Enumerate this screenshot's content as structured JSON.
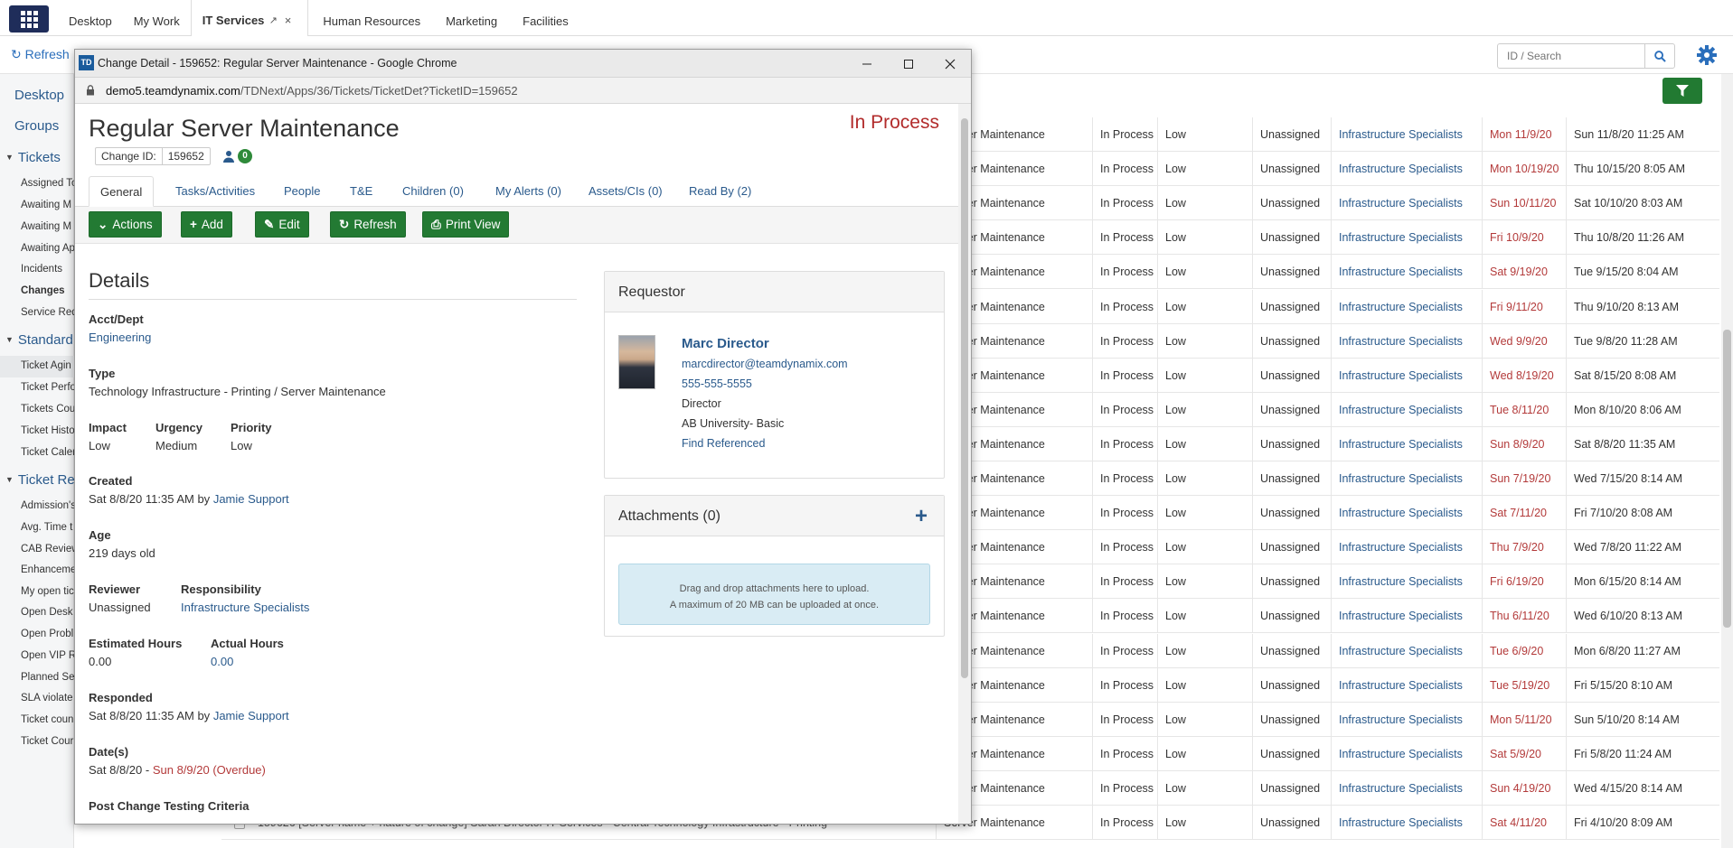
{
  "top_tabs": [
    {
      "label": "Desktop"
    },
    {
      "label": "My Work"
    },
    {
      "label": "IT Services",
      "pin_icon": "↗",
      "close_icon": "×"
    },
    {
      "label": "Human Resources"
    },
    {
      "label": "Marketing"
    },
    {
      "label": "Facilities"
    }
  ],
  "subbar": {
    "refresh_label": "Refresh",
    "search_placeholder": "ID / Search"
  },
  "leftnav": {
    "top_links": [
      "Desktop",
      "Groups"
    ],
    "sections": [
      {
        "title": "Tickets",
        "items": [
          "Assigned To",
          "Awaiting M",
          "Awaiting M",
          "Awaiting Ap",
          "Incidents",
          "Changes",
          "Service Req"
        ]
      },
      {
        "title": "Standard R",
        "items": [
          "Ticket Agin",
          "Ticket Perfo",
          "Tickets Cou",
          "Ticket Histo",
          "Ticket Caler"
        ]
      },
      {
        "title": "Ticket Rep",
        "items": [
          "Admission's",
          "Avg. Time t",
          "CAB Review",
          "Enhanceme",
          "My open tic",
          "Open Desk",
          "Open Probl",
          "Open VIP R",
          "Planned Se",
          "SLA violate",
          "Ticket coun",
          "Ticket Cour"
        ]
      }
    ],
    "selected_item": "Changes"
  },
  "table": {
    "rows": [
      {
        "subject": "Server Maintenance",
        "status": "In Process",
        "priority": "Low",
        "assigned": "Unassigned",
        "responsibility": "Infrastructure Specialists",
        "due": "Mon 11/9/20",
        "modified": "Sun 11/8/20 11:25 AM"
      },
      {
        "subject": "Server Maintenance",
        "status": "In Process",
        "priority": "Low",
        "assigned": "Unassigned",
        "responsibility": "Infrastructure Specialists",
        "due": "Mon 10/19/20",
        "modified": "Thu 10/15/20 8:05 AM"
      },
      {
        "subject": "Server Maintenance",
        "status": "In Process",
        "priority": "Low",
        "assigned": "Unassigned",
        "responsibility": "Infrastructure Specialists",
        "due": "Sun 10/11/20",
        "modified": "Sat 10/10/20 8:03 AM"
      },
      {
        "subject": "Server Maintenance",
        "status": "In Process",
        "priority": "Low",
        "assigned": "Unassigned",
        "responsibility": "Infrastructure Specialists",
        "due": "Fri 10/9/20",
        "modified": "Thu 10/8/20 11:26 AM"
      },
      {
        "subject": "Server Maintenance",
        "status": "In Process",
        "priority": "Low",
        "assigned": "Unassigned",
        "responsibility": "Infrastructure Specialists",
        "due": "Sat 9/19/20",
        "modified": "Tue 9/15/20 8:04 AM"
      },
      {
        "subject": "Server Maintenance",
        "status": "In Process",
        "priority": "Low",
        "assigned": "Unassigned",
        "responsibility": "Infrastructure Specialists",
        "due": "Fri 9/11/20",
        "modified": "Thu 9/10/20 8:13 AM"
      },
      {
        "subject": "Server Maintenance",
        "status": "In Process",
        "priority": "Low",
        "assigned": "Unassigned",
        "responsibility": "Infrastructure Specialists",
        "due": "Wed 9/9/20",
        "modified": "Tue 9/8/20 11:28 AM"
      },
      {
        "subject": "Server Maintenance",
        "status": "In Process",
        "priority": "Low",
        "assigned": "Unassigned",
        "responsibility": "Infrastructure Specialists",
        "due": "Wed 8/19/20",
        "modified": "Sat 8/15/20 8:08 AM"
      },
      {
        "subject": "Server Maintenance",
        "status": "In Process",
        "priority": "Low",
        "assigned": "Unassigned",
        "responsibility": "Infrastructure Specialists",
        "due": "Tue 8/11/20",
        "modified": "Mon 8/10/20 8:06 AM"
      },
      {
        "subject": "Server Maintenance",
        "status": "In Process",
        "priority": "Low",
        "assigned": "Unassigned",
        "responsibility": "Infrastructure Specialists",
        "due": "Sun 8/9/20",
        "modified": "Sat 8/8/20 11:35 AM"
      },
      {
        "subject": "Server Maintenance",
        "status": "In Process",
        "priority": "Low",
        "assigned": "Unassigned",
        "responsibility": "Infrastructure Specialists",
        "due": "Sun 7/19/20",
        "modified": "Wed 7/15/20 8:14 AM"
      },
      {
        "subject": "Server Maintenance",
        "status": "In Process",
        "priority": "Low",
        "assigned": "Unassigned",
        "responsibility": "Infrastructure Specialists",
        "due": "Sat 7/11/20",
        "modified": "Fri 7/10/20 8:08 AM"
      },
      {
        "subject": "Server Maintenance",
        "status": "In Process",
        "priority": "Low",
        "assigned": "Unassigned",
        "responsibility": "Infrastructure Specialists",
        "due": "Thu 7/9/20",
        "modified": "Wed 7/8/20 11:22 AM"
      },
      {
        "subject": "Server Maintenance",
        "status": "In Process",
        "priority": "Low",
        "assigned": "Unassigned",
        "responsibility": "Infrastructure Specialists",
        "due": "Fri 6/19/20",
        "modified": "Mon 6/15/20 8:14 AM"
      },
      {
        "subject": "Server Maintenance",
        "status": "In Process",
        "priority": "Low",
        "assigned": "Unassigned",
        "responsibility": "Infrastructure Specialists",
        "due": "Thu 6/11/20",
        "modified": "Wed 6/10/20 8:13 AM"
      },
      {
        "subject": "Server Maintenance",
        "status": "In Process",
        "priority": "Low",
        "assigned": "Unassigned",
        "responsibility": "Infrastructure Specialists",
        "due": "Tue 6/9/20",
        "modified": "Mon 6/8/20 11:27 AM"
      },
      {
        "subject": "Server Maintenance",
        "status": "In Process",
        "priority": "Low",
        "assigned": "Unassigned",
        "responsibility": "Infrastructure Specialists",
        "due": "Tue 5/19/20",
        "modified": "Fri 5/15/20 8:10 AM"
      },
      {
        "subject": "Server Maintenance",
        "status": "In Process",
        "priority": "Low",
        "assigned": "Unassigned",
        "responsibility": "Infrastructure Specialists",
        "due": "Mon 5/11/20",
        "modified": "Sun 5/10/20 8:14 AM"
      },
      {
        "subject": "Server Maintenance",
        "status": "In Process",
        "priority": "Low",
        "assigned": "Unassigned",
        "responsibility": "Infrastructure Specialists",
        "due": "Sat 5/9/20",
        "modified": "Fri 5/8/20 11:24 AM"
      },
      {
        "subject": "Server Maintenance",
        "status": "In Process",
        "priority": "Low",
        "assigned": "Unassigned",
        "responsibility": "Infrastructure Specialists",
        "due": "Sun 4/19/20",
        "modified": "Wed 4/15/20 8:14 AM"
      },
      {
        "subject": "Server Maintenance",
        "status": "In Process",
        "priority": "Low",
        "assigned": "Unassigned",
        "responsibility": "Infrastructure Specialists",
        "due": "Sat 4/11/20",
        "modified": "Fri 4/10/20 8:09 AM",
        "lead": "159626   [Server name + nature of change]   Sarah Director   IT Services - Central   Technology Infrastructure - Printing"
      }
    ]
  },
  "popup": {
    "window_title": "Change Detail - 159652: Regular Server Maintenance - Google Chrome",
    "td_badge": "TD",
    "url_domain": "demo5.teamdynamix.com",
    "url_path": "/TDNext/Apps/36/Tickets/TicketDet?TicketID=159652",
    "title": "Regular Server Maintenance",
    "status": "In Process",
    "change_id_label": "Change ID:",
    "change_id": "159652",
    "people_count": "0",
    "tabs": [
      "General",
      "Tasks/Activities",
      "People",
      "T&E",
      "Children (0)",
      "My Alerts (0)",
      "Assets/CIs (0)",
      "Read By (2)"
    ],
    "buttons": {
      "actions": "Actions",
      "add": "Add",
      "edit": "Edit",
      "refresh": "Refresh",
      "print": "Print View"
    },
    "details_heading": "Details",
    "fields": {
      "acct_label": "Acct/Dept",
      "acct_value": "Engineering",
      "type_label": "Type",
      "type_value": "Technology Infrastructure - Printing / Server Maintenance",
      "impact_label": "Impact",
      "impact_value": "Low",
      "urgency_label": "Urgency",
      "urgency_value": "Medium",
      "priority_label": "Priority",
      "priority_value": "Low",
      "created_label": "Created",
      "created_value": "Sat 8/8/20 11:35 AM by",
      "created_by": "Jamie Support",
      "age_label": "Age",
      "age_value": "219 days old",
      "reviewer_label": "Reviewer",
      "reviewer_value": "Unassigned",
      "responsibility_label": "Responsibility",
      "responsibility_value": "Infrastructure Specialists",
      "est_hours_label": "Estimated Hours",
      "est_hours_value": "0.00",
      "act_hours_label": "Actual Hours",
      "act_hours_value": "0.00",
      "responded_label": "Responded",
      "responded_value": "Sat 8/8/20 11:35 AM by",
      "responded_by": "Jamie Support",
      "dates_label": "Date(s)",
      "dates_start": "Sat 8/8/20 -",
      "dates_end": "Sun 8/9/20 (Overdue)",
      "post_change_label": "Post Change Testing Criteria"
    },
    "requestor": {
      "heading": "Requestor",
      "name": "Marc Director",
      "email": "marcdirector@teamdynamix.com",
      "phone": "555-555-5555",
      "title": "Director",
      "org": "AB University- Basic",
      "find_link": "Find Referenced"
    },
    "attachments": {
      "heading": "Attachments (0)",
      "drop_line1": "Drag and drop attachments here to upload.",
      "drop_line2": "A maximum of 20 MB can be uploaded at once."
    }
  },
  "colors": {
    "accent_green": "#237a33",
    "status_red": "#b22b2b",
    "link_blue": "#2a5a8c",
    "brand_navy": "#1f2d5a"
  }
}
